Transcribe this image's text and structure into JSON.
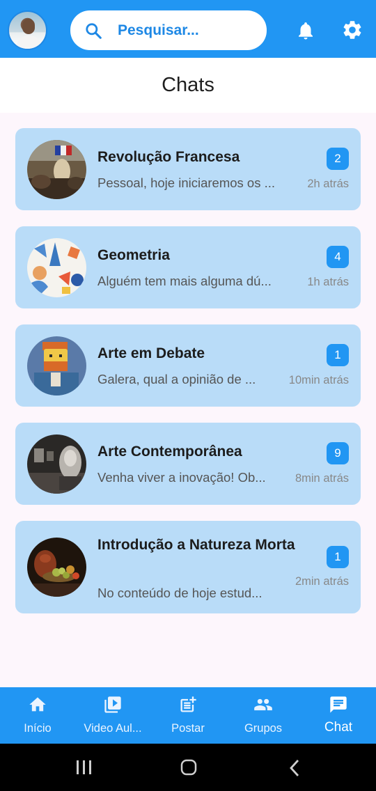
{
  "header": {
    "search_placeholder": "Pesquisar...",
    "page_title": "Chats"
  },
  "chats": [
    {
      "name": "Revolução Francesa",
      "preview": "Pessoal, hoje iniciaremos os ...",
      "time": "2h atrás",
      "unread": "2",
      "image": "liberty-painting"
    },
    {
      "name": "Geometria",
      "preview": "Alguém tem mais alguma dú...",
      "time": "1h atrás",
      "unread": "4",
      "image": "geometry-shapes"
    },
    {
      "name": "Arte em Debate",
      "preview": "Galera, qual a opinião de ...",
      "time": "10min atrás",
      "unread": "1",
      "image": "van-gogh-lego"
    },
    {
      "name": "Arte Contemporânea",
      "preview": "Venha viver a inovação! Ob...",
      "time": "8min atrás",
      "unread": "9",
      "image": "gallery-room"
    },
    {
      "name": "Introdução a Natureza Morta",
      "preview": "No conteúdo de hoje estud...",
      "time": "2min atrás",
      "unread": "1",
      "image": "still-life-fruit"
    }
  ],
  "bottom_nav": [
    {
      "label": "Início",
      "icon": "home-icon"
    },
    {
      "label": "Video Aul...",
      "icon": "video-library-icon"
    },
    {
      "label": "Postar",
      "icon": "post-add-icon"
    },
    {
      "label": "Grupos",
      "icon": "groups-icon"
    },
    {
      "label": "Chat",
      "icon": "chat-icon",
      "active": true
    }
  ],
  "colors": {
    "primary": "#2196f3",
    "card": "#b9dcf8",
    "background": "#fdf6fc"
  }
}
